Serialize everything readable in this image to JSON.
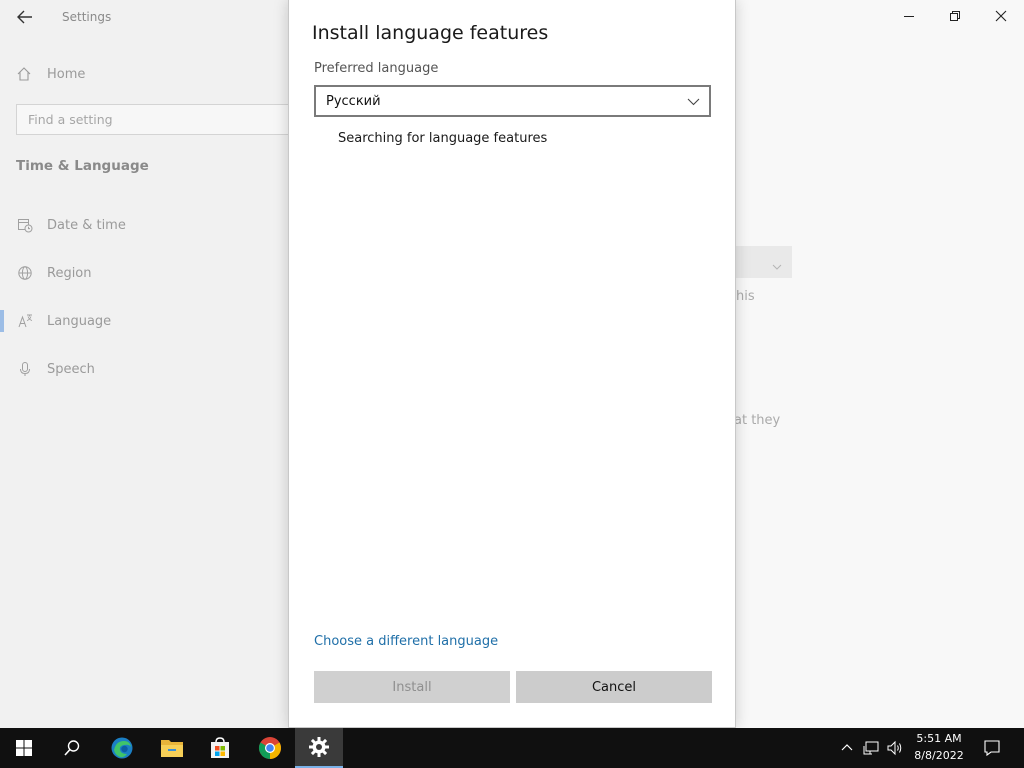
{
  "settings": {
    "app_title": "Settings",
    "home_label": "Home",
    "search_placeholder": "Find a setting",
    "section_title": "Time & Language",
    "nav_items": [
      {
        "label": "Date & time",
        "icon": "date-time-icon"
      },
      {
        "label": "Region",
        "icon": "globe-icon"
      },
      {
        "label": "Language",
        "icon": "language-icon",
        "active": true
      },
      {
        "label": "Speech",
        "icon": "microphone-icon"
      }
    ],
    "background_text": [
      "his",
      "at they"
    ]
  },
  "dialog": {
    "title": "Install language features",
    "preferred_label": "Preferred language",
    "selected_language": "Русский",
    "status": "Searching for language features",
    "link": "Choose a different language",
    "install_label": "Install",
    "cancel_label": "Cancel"
  },
  "taskbar": {
    "time": "5:51 AM",
    "date": "8/8/2022",
    "apps": [
      "start-icon",
      "search-icon",
      "edge-icon",
      "file-explorer-icon",
      "store-icon",
      "chrome-icon",
      "settings-icon"
    ]
  },
  "colors": {
    "accent": "#1f6fa8",
    "active_indicator": "#9cbde6",
    "taskbar": "#101010"
  }
}
